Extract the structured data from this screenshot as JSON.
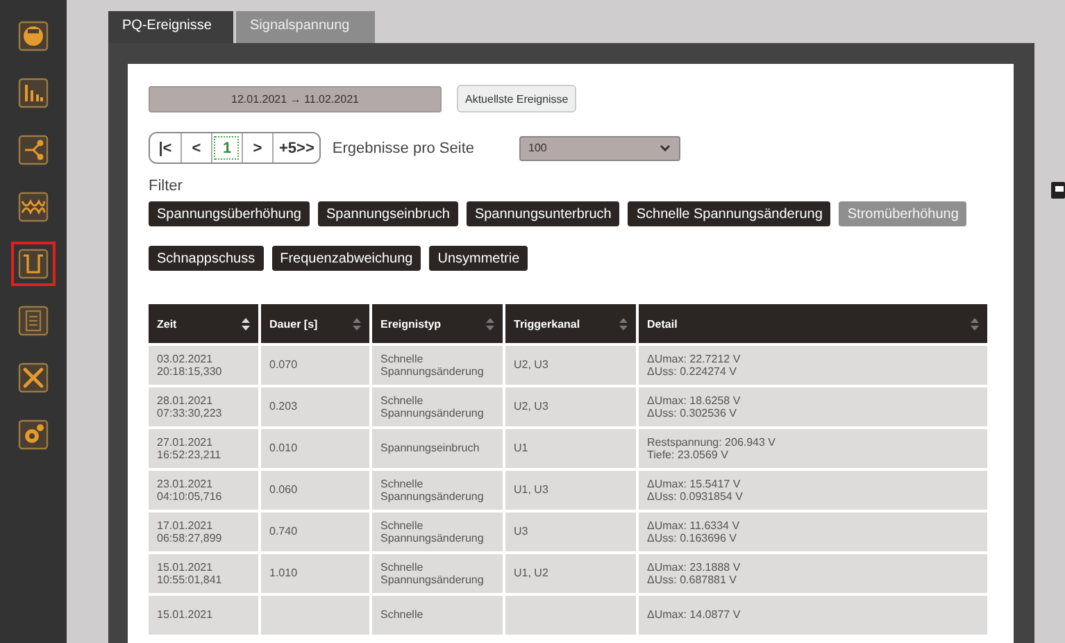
{
  "sidebar": {
    "items": [
      {
        "kind": "meter",
        "selected": false
      },
      {
        "kind": "bars",
        "selected": false
      },
      {
        "kind": "nodes",
        "selected": false
      },
      {
        "kind": "coils",
        "selected": false
      },
      {
        "kind": "pulse",
        "selected": true
      },
      {
        "kind": "list",
        "selected": false
      },
      {
        "kind": "tools",
        "selected": false
      },
      {
        "kind": "gear",
        "selected": false
      }
    ]
  },
  "tabs": [
    {
      "label": "PQ-Ereignisse",
      "selected": true
    },
    {
      "label": "Signalspannung",
      "selected": false
    }
  ],
  "date_range": "12.01.2021 → 11.02.2021",
  "latest_button": "Aktuellste Ereignisse",
  "pager": [
    {
      "label": "|<",
      "selected": false
    },
    {
      "label": "<",
      "selected": false
    },
    {
      "label": "1",
      "selected": true
    },
    {
      "label": ">",
      "selected": false
    },
    {
      "label": "+5>>",
      "selected": false
    }
  ],
  "per_page": {
    "label": "Ergebnisse pro Seite",
    "value": "100"
  },
  "filter": {
    "label": "Filter",
    "chips": [
      {
        "label": "Spannungsüberhöhung",
        "disabled": false
      },
      {
        "label": "Spannungseinbruch",
        "disabled": false
      },
      {
        "label": "Spannungsunterbruch",
        "disabled": false
      },
      {
        "label": "Schnelle Spannungsänderung",
        "disabled": false
      },
      {
        "label": "Stromüberhöhung",
        "disabled": true
      },
      {
        "label": "Schnappschuss",
        "disabled": false
      },
      {
        "label": "Frequenzabweichung",
        "disabled": false
      },
      {
        "label": "Unsymmetrie",
        "disabled": false
      }
    ]
  },
  "table": {
    "columns": [
      {
        "label": "Zeit",
        "sorted": true
      },
      {
        "label": "Dauer [s]",
        "sorted": false
      },
      {
        "label": "Ereignistyp",
        "sorted": false
      },
      {
        "label": "Triggerkanal",
        "sorted": false
      },
      {
        "label": "Detail",
        "sorted": false
      }
    ],
    "rows": [
      {
        "time": [
          "03.02.2021",
          "20:18:15,330"
        ],
        "duration": "0.070",
        "type": [
          "Schnelle",
          "Spannungsänderung"
        ],
        "trigger": "U2, U3",
        "detail": [
          "ΔUmax: 22.7212 V",
          "ΔUss: 0.224274 V"
        ]
      },
      {
        "time": [
          "28.01.2021",
          "07:33:30,223"
        ],
        "duration": "0.203",
        "type": [
          "Schnelle",
          "Spannungsänderung"
        ],
        "trigger": "U2, U3",
        "detail": [
          "ΔUmax: 18.6258 V",
          "ΔUss: 0.302536 V"
        ]
      },
      {
        "time": [
          "27.01.2021",
          "16:52:23,211"
        ],
        "duration": "0.010",
        "type": [
          "Spannungseinbruch"
        ],
        "trigger": "U1",
        "detail": [
          "Restspannung: 206.943 V",
          "Tiefe: 23.0569 V"
        ]
      },
      {
        "time": [
          "23.01.2021",
          "04:10:05,716"
        ],
        "duration": "0.060",
        "type": [
          "Schnelle",
          "Spannungsänderung"
        ],
        "trigger": "U1, U3",
        "detail": [
          "ΔUmax: 15.5417 V",
          "ΔUss: 0.0931854 V"
        ]
      },
      {
        "time": [
          "17.01.2021",
          "06:58:27,899"
        ],
        "duration": "0.740",
        "type": [
          "Schnelle",
          "Spannungsänderung"
        ],
        "trigger": "U3",
        "detail": [
          "ΔUmax: 11.6334 V",
          "ΔUss: 0.163696 V"
        ]
      },
      {
        "time": [
          "15.01.2021",
          "10:55:01,841"
        ],
        "duration": "1.010",
        "type": [
          "Schnelle",
          "Spannungsänderung"
        ],
        "trigger": "U1, U2",
        "detail": [
          "ΔUmax: 23.1888 V",
          "ΔUss: 0.687881 V"
        ]
      },
      {
        "time": [
          "15.01.2021"
        ],
        "type": [
          "Schnelle"
        ],
        "detail": [
          "ΔUmax: 14.0877 V"
        ]
      }
    ]
  }
}
